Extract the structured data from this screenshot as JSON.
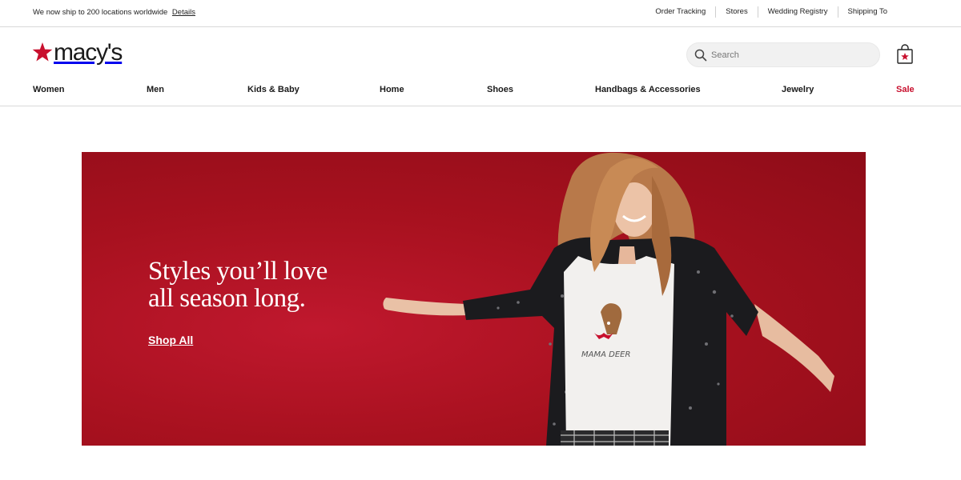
{
  "utility": {
    "promo_text": "We now ship to 200 locations worldwide",
    "promo_link": "Details",
    "links": [
      "Order Tracking",
      "Stores",
      "Wedding Registry",
      "Shipping To"
    ]
  },
  "brand": {
    "name": "macy's",
    "accent_color": "#c8102e"
  },
  "search": {
    "placeholder": "Search",
    "icon": "search-icon"
  },
  "cart": {
    "icon": "shopping-bag-icon"
  },
  "nav": {
    "items": [
      "Women",
      "Men",
      "Kids & Baby",
      "Home",
      "Shoes",
      "Handbags & Accessories",
      "Jewelry",
      "Sale"
    ]
  },
  "hero": {
    "headline_line1": "Styles you’ll love",
    "headline_line2": "all season long.",
    "cta": "Shop All",
    "background_color": "#a8111f",
    "shirt_text": "MAMA DEER"
  }
}
